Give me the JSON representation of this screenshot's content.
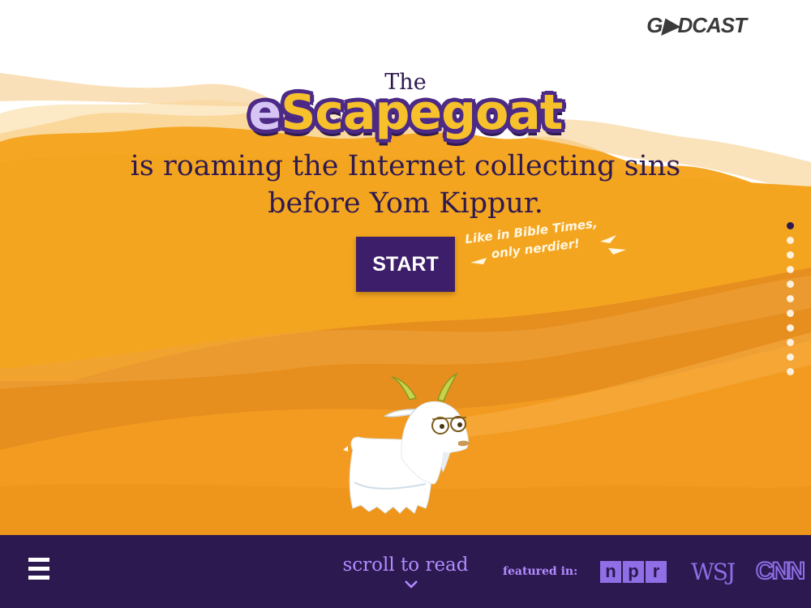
{
  "brand": {
    "logo": "G▶DCAST"
  },
  "hero": {
    "pre_title": "The",
    "title_first": "e",
    "title_rest": "Scapegoat",
    "tagline_line1": "is roaming the Internet collecting sins",
    "tagline_line2": "before Yom Kippur."
  },
  "cta": {
    "start_label": "START",
    "note_line1": "Like in Bible Times,",
    "note_line2": "only nerdier!"
  },
  "pagination": {
    "total": 11,
    "active_index": 0
  },
  "footer": {
    "menu_icon": "hamburger-icon",
    "scroll_label": "scroll to read",
    "scroll_icon": "chevron-down-icon",
    "featured_label": "featured in:",
    "npr_letters": [
      "n",
      "p",
      "r"
    ],
    "wsj": "WSJ",
    "cnn": "CNN"
  },
  "colors": {
    "sky": "#ffffff",
    "desert": "#f4a623",
    "dune_dark": "#e8911a",
    "bar": "#2c1950",
    "button": "#3d1e6a",
    "accent": "#b28cff",
    "title_fill": "#f6c12a"
  }
}
